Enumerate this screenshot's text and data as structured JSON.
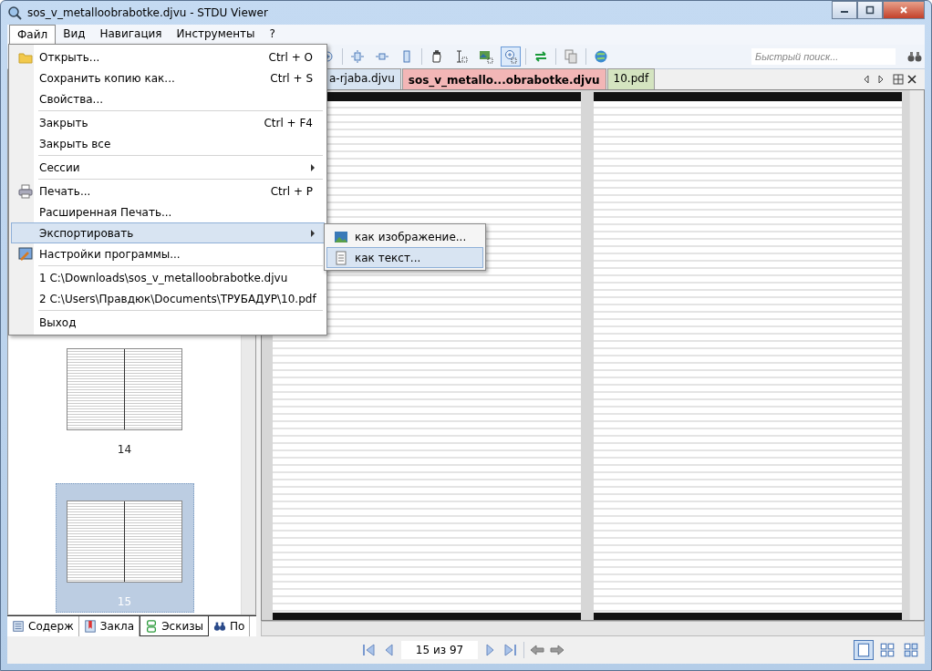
{
  "window": {
    "title": "sos_v_metalloobrabotke.djvu - STDU Viewer"
  },
  "menu_bar": [
    {
      "label": "Файл",
      "selected": true
    },
    {
      "label": "Вид",
      "selected": false
    },
    {
      "label": "Навигация",
      "selected": false
    },
    {
      "label": "Инструменты",
      "selected": false
    },
    {
      "label": "?",
      "selected": false
    }
  ],
  "file_menu": [
    {
      "kind": "item",
      "label": "Открыть...",
      "shortcut": "Ctrl + O",
      "highlighted": false
    },
    {
      "kind": "item",
      "label": "Сохранить копию как...",
      "shortcut": "Ctrl + S",
      "highlighted": false
    },
    {
      "kind": "item",
      "label": "Свойства...",
      "highlighted": false
    },
    {
      "kind": "separator"
    },
    {
      "kind": "item",
      "label": "Закрыть",
      "shortcut": "Ctrl + F4",
      "highlighted": false
    },
    {
      "kind": "item",
      "label": "Закрыть все",
      "highlighted": false
    },
    {
      "kind": "separator"
    },
    {
      "kind": "submenu",
      "label": "Сессии",
      "highlighted": false
    },
    {
      "kind": "separator"
    },
    {
      "kind": "item",
      "label": "Печать...",
      "shortcut": "Ctrl + P",
      "highlighted": false
    },
    {
      "kind": "item",
      "label": "Расширенная Печать...",
      "highlighted": false
    },
    {
      "kind": "submenu",
      "label": "Экспортировать",
      "highlighted": true
    },
    {
      "kind": "item",
      "label": "Настройки программы...",
      "highlighted": false
    },
    {
      "kind": "separator"
    },
    {
      "kind": "item",
      "label": "1 C:\\Downloads\\sos_v_metalloobrabotke.djvu",
      "highlighted": false
    },
    {
      "kind": "item",
      "label": "2 C:\\Users\\Правдюк\\Documents\\ТРУБАДУР\\10.pdf",
      "highlighted": false
    },
    {
      "kind": "separator"
    },
    {
      "kind": "item",
      "label": "Выход",
      "highlighted": false
    }
  ],
  "export_submenu": [
    {
      "label": "как изображение...",
      "highlighted": false
    },
    {
      "label": "как текст...",
      "highlighted": true
    }
  ],
  "toolbar_tools": [
    {
      "selected": false
    },
    {
      "selected": false
    },
    {
      "selected": false
    },
    {
      "selected": false
    },
    {
      "selected": false
    },
    {
      "selected": false
    },
    {
      "selected": false
    },
    {
      "selected": true
    },
    {
      "selected": false
    },
    {
      "selected": false
    },
    {
      "selected": false
    }
  ],
  "search": {
    "placeholder": "Быстрый поиск..."
  },
  "document_tabs": [
    {
      "label": "a-rjaba.djvu",
      "selected": false,
      "color": "#d7e4f2"
    },
    {
      "label": "sos_v_metallo...obrabotke.djvu",
      "selected": true,
      "color": "#f2b6b6"
    },
    {
      "label": "10.pdf",
      "selected": false,
      "color": "#d4e4c0"
    }
  ],
  "thumbnails": [
    {
      "label": "14",
      "selected": false
    },
    {
      "label": "15",
      "selected": true
    }
  ],
  "side_tabs": [
    {
      "label": "Содерж",
      "selected": false
    },
    {
      "label": "Закла",
      "selected": false
    },
    {
      "label": "Эскизы",
      "selected": true
    },
    {
      "label": "По",
      "selected": false
    }
  ],
  "navigation": {
    "page": "15 из 97"
  },
  "view_modes": [
    {
      "selected": true
    },
    {
      "selected": false
    },
    {
      "selected": false
    }
  ]
}
